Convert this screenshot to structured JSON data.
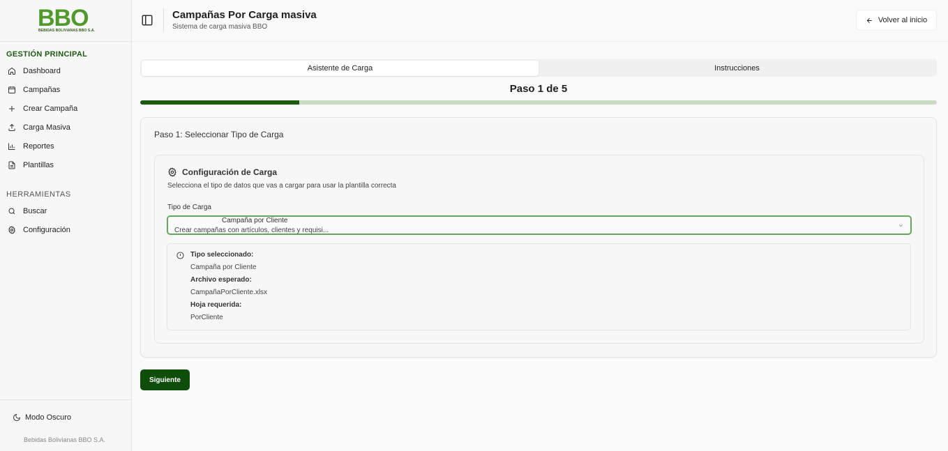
{
  "brand": {
    "logo_text": "BBO",
    "logo_subtext": "BEBIDAS BOLIVIANAS BBO S.A.",
    "primary_color": "#1c5a10",
    "logo_green": "#4f9a2a"
  },
  "sidebar": {
    "section_main": "GESTIÓN PRINCIPAL",
    "main_items": [
      {
        "label": "Dashboard",
        "icon": "home-icon"
      },
      {
        "label": "Campañas",
        "icon": "calendar-icon"
      },
      {
        "label": "Crear Campaña",
        "icon": "plus-icon"
      },
      {
        "label": "Carga Masiva",
        "icon": "upload-icon"
      },
      {
        "label": "Reportes",
        "icon": "bar-chart-icon"
      },
      {
        "label": "Plantillas",
        "icon": "document-icon"
      }
    ],
    "section_tools": "HERRAMIENTAS",
    "tool_items": [
      {
        "label": "Buscar",
        "icon": "search-icon"
      },
      {
        "label": "Configuración",
        "icon": "gear-icon"
      }
    ],
    "dark_mode_label": "Modo Oscuro",
    "footer_company": "Bebidas Bolivianas BBO S.A."
  },
  "header": {
    "title": "Campañas Por Carga masiva",
    "subtitle": "Sistema de carga masiva BBO",
    "back_label": "Volver al inicio"
  },
  "tabs": [
    {
      "label": "Asistente de Carga",
      "active": true
    },
    {
      "label": "Instrucciones",
      "active": false
    }
  ],
  "wizard": {
    "step_title": "Paso 1 de 5",
    "progress_fraction": 0.2,
    "card_title": "Paso 1: Seleccionar Tipo de Carga",
    "config_title": "Configuración de Carga",
    "config_desc": "Selecciona el tipo de datos que vas a cargar para usar la plantilla correcta",
    "field_label": "Tipo de Carga",
    "select_value": "Campaña por Cliente",
    "select_description": "Crear campañas con artículos, clientes y requisi...",
    "info": {
      "type_label": "Tipo seleccionado:",
      "type_value": "Campaña por Cliente",
      "file_label": "Archivo esperado:",
      "file_value": "CampañaPorCliente.xlsx",
      "sheet_label": "Hoja requerida:",
      "sheet_value": "PorCliente"
    },
    "next_label": "Siguiente"
  }
}
